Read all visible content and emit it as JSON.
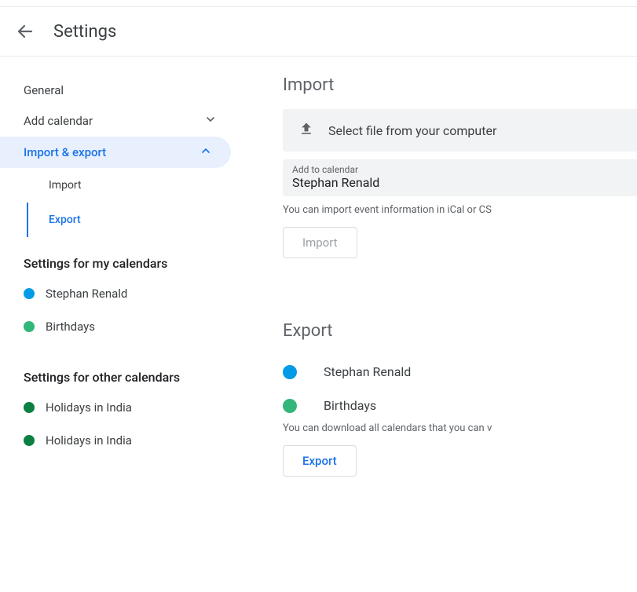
{
  "header": {
    "title": "Settings"
  },
  "sidebar": {
    "general": "General",
    "add_calendar": "Add calendar",
    "import_export": "Import & export",
    "sub": {
      "import": "Import",
      "export": "Export"
    },
    "settings_my_cals": "Settings for my calendars",
    "my_calendars": [
      {
        "name": "Stephan Renald",
        "color": "#039be5"
      },
      {
        "name": "Birthdays",
        "color": "#33b679"
      }
    ],
    "settings_other_cals": "Settings for other calendars",
    "other_calendars": [
      {
        "name": "Holidays in India",
        "color": "#0b8043"
      },
      {
        "name": "Holidays in India",
        "color": "#0b8043"
      }
    ]
  },
  "main": {
    "import": {
      "title": "Import",
      "select_file": "Select file from your computer",
      "add_to_label": "Add to calendar",
      "add_to_value": "Stephan Renald",
      "helper": "You can import event information in iCal or CS",
      "button": "Import"
    },
    "export": {
      "title": "Export",
      "calendars": [
        {
          "name": "Stephan Renald",
          "color": "#039be5"
        },
        {
          "name": "Birthdays",
          "color": "#33b679"
        }
      ],
      "helper": "You can download all calendars that you can v",
      "button": "Export"
    }
  }
}
